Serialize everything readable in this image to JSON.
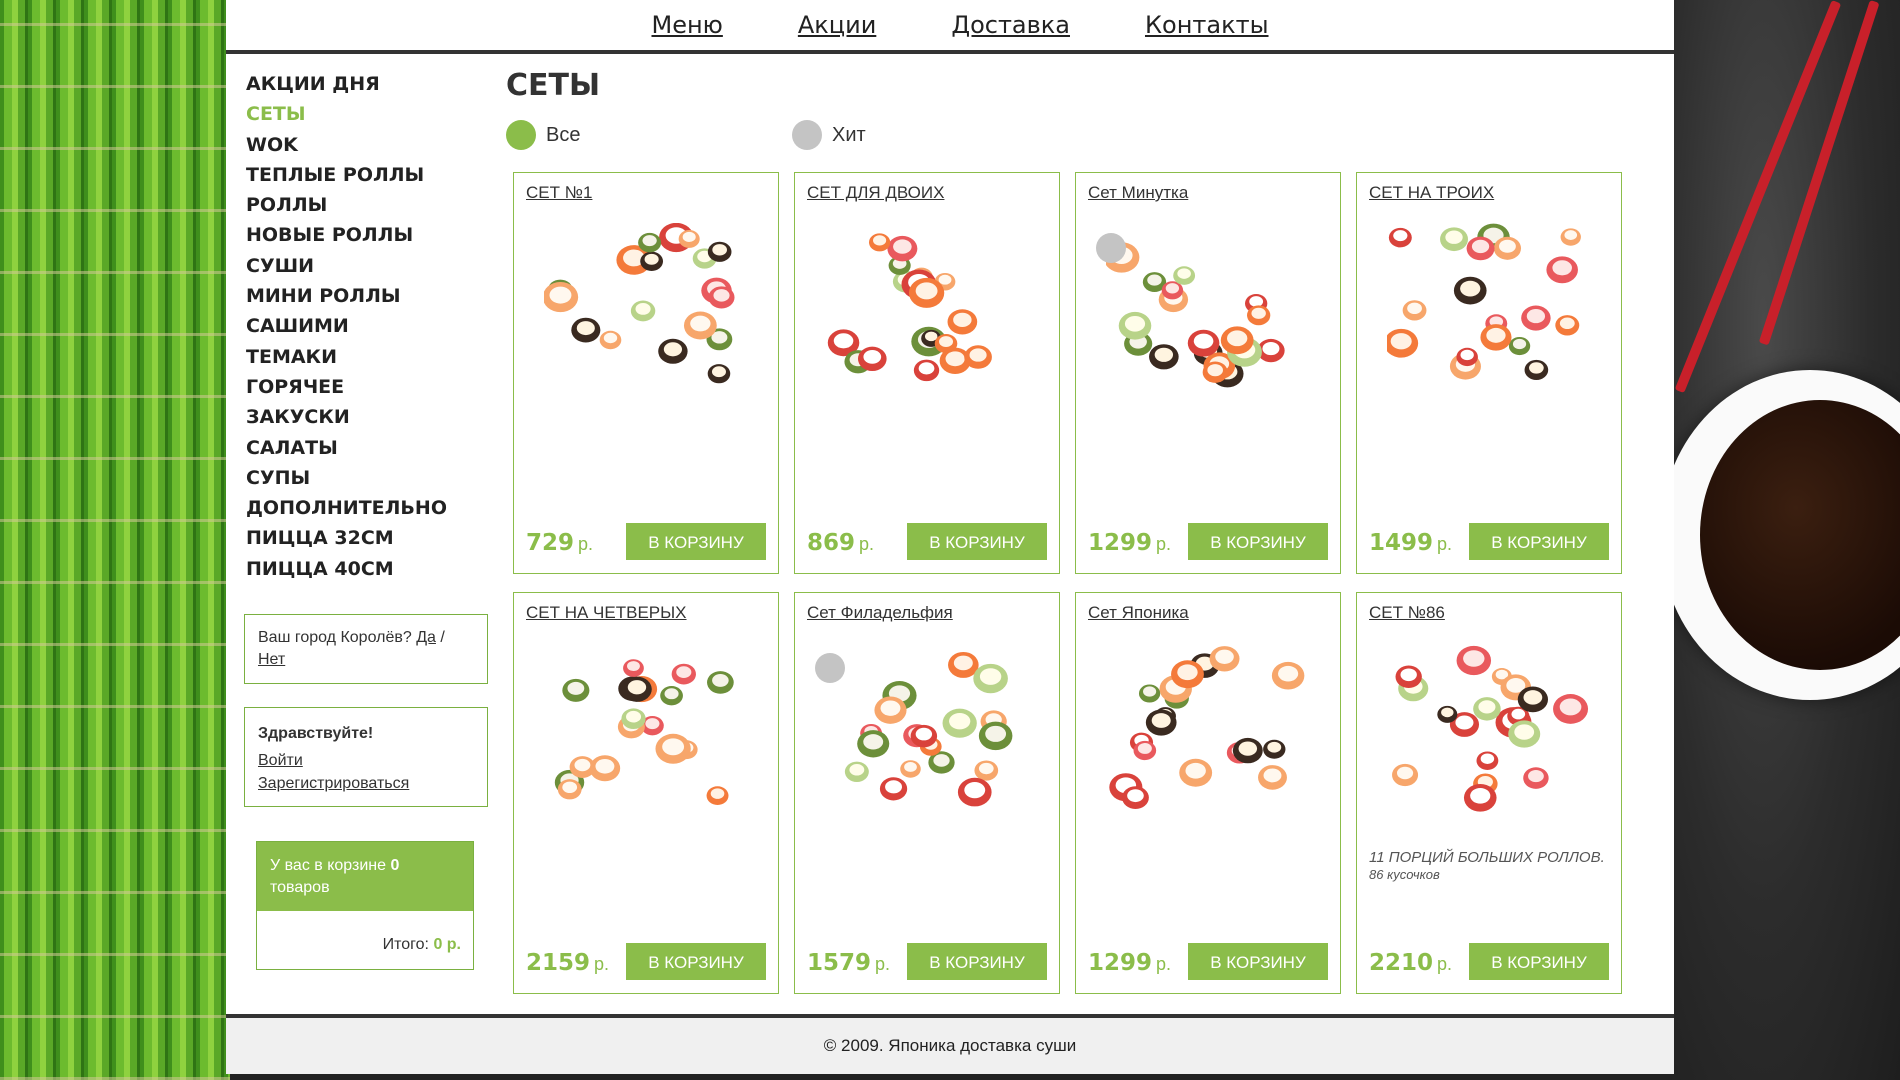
{
  "nav": [
    "Меню",
    "Акции",
    "Доставка",
    "Контакты"
  ],
  "heading": "СЕТЫ",
  "categories": [
    "АКЦИИ ДНЯ",
    "СЕТЫ",
    "WOK",
    "ТЕПЛЫЕ РОЛЛЫ",
    "РОЛЛЫ",
    "НОВЫЕ РОЛЛЫ",
    "СУШИ",
    "МИНИ РОЛЛЫ",
    "САШИМИ",
    "ТЕМАКИ",
    "ГОРЯЧЕЕ",
    "ЗАКУСКИ",
    "САЛАТЫ",
    "СУПЫ",
    "ДОПОЛНИТЕЛЬНО",
    "ПИЦЦА 32СМ",
    "ПИЦЦА 40СМ"
  ],
  "active_category": "СЕТЫ",
  "filters": {
    "all": "Все",
    "hit": "Хит"
  },
  "city": {
    "question": "Ваш город Королёв?",
    "yes": "Да",
    "separator": "/",
    "no": "Нет"
  },
  "greeting": {
    "title": "Здравствуйте!",
    "login": "Войти",
    "register": "Зарегистрироваться"
  },
  "cart": {
    "text_before": "У вас в корзине",
    "count": "0",
    "text_after": "товаров",
    "total_label": "Итого:",
    "total_value": "0 р."
  },
  "products": [
    {
      "name": "СЕТ №1",
      "price": "729",
      "currency": "р.",
      "button": "В КОРЗИНУ",
      "hit": false,
      "desc": "",
      "desc_small": ""
    },
    {
      "name": "СЕТ ДЛЯ ДВОИХ",
      "price": "869",
      "currency": "р.",
      "button": "В КОРЗИНУ",
      "hit": false,
      "desc": "",
      "desc_small": ""
    },
    {
      "name": "Сет Минутка",
      "price": "1299",
      "currency": "р.",
      "button": "В КОРЗИНУ",
      "hit": true,
      "desc": "",
      "desc_small": ""
    },
    {
      "name": "СЕТ НА ТРОИХ",
      "price": "1499",
      "currency": "р.",
      "button": "В КОРЗИНУ",
      "hit": false,
      "desc": "",
      "desc_small": ""
    },
    {
      "name": "СЕТ НА ЧЕТВЕРЫХ",
      "price": "2159",
      "currency": "р.",
      "button": "В КОРЗИНУ",
      "hit": false,
      "desc": "",
      "desc_small": ""
    },
    {
      "name": "Сет Филадельфия",
      "price": "1579",
      "currency": "р.",
      "button": "В КОРЗИНУ",
      "hit": true,
      "desc": "",
      "desc_small": ""
    },
    {
      "name": "Сет Японика",
      "price": "1299",
      "currency": "р.",
      "button": "В КОРЗИНУ",
      "hit": false,
      "desc": "",
      "desc_small": ""
    },
    {
      "name": "СЕТ №86",
      "price": "2210",
      "currency": "р.",
      "button": "В КОРЗИНУ",
      "hit": false,
      "desc": "11 ПОРЦИЙ БОЛЬШИХ РОЛЛОВ.",
      "desc_small": "86 кусочков"
    }
  ],
  "footer": "© 2009. Японика доставка суши",
  "colors": {
    "accent": "#8bbd4a",
    "hit_dot": "#c4c4c4",
    "text": "#333333"
  }
}
